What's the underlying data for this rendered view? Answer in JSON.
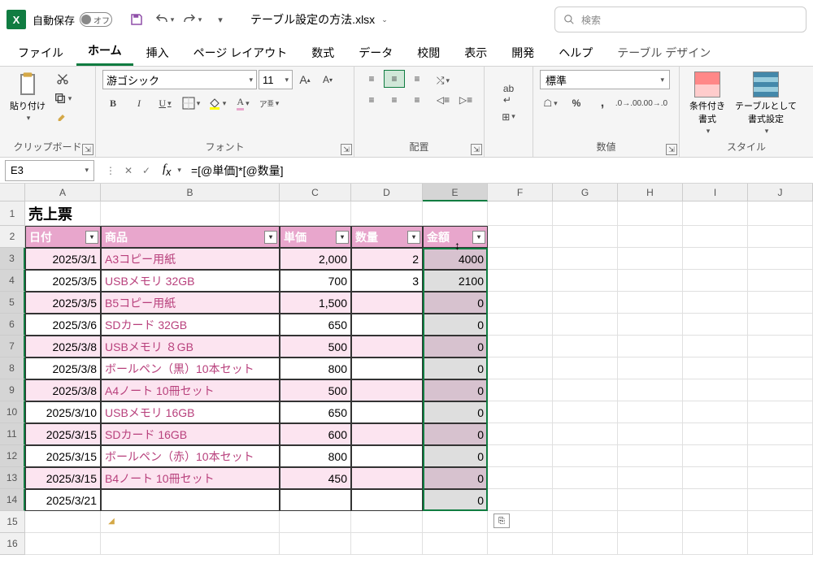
{
  "titlebar": {
    "autosave_label": "自動保存",
    "autosave_state": "オフ",
    "filename": "テーブル設定の方法.xlsx"
  },
  "search": {
    "placeholder": "検索"
  },
  "tabs": {
    "file": "ファイル",
    "home": "ホーム",
    "insert": "挿入",
    "page_layout": "ページ レイアウト",
    "formulas": "数式",
    "data": "データ",
    "review": "校閲",
    "view": "表示",
    "developer": "開発",
    "help": "ヘルプ",
    "table_design": "テーブル デザイン"
  },
  "ribbon": {
    "clipboard": {
      "paste": "貼り付け",
      "group": "クリップボード"
    },
    "font": {
      "name": "游ゴシック",
      "size": "11",
      "group": "フォント"
    },
    "align": {
      "group": "配置"
    },
    "number": {
      "format": "標準",
      "group": "数値"
    },
    "styles": {
      "cond_fmt": "条件付き\n書式",
      "as_table": "テーブルとして\n書式設定",
      "group": "スタイル"
    }
  },
  "namebox": "E3",
  "formula": "=[@単価]*[@数量]",
  "cols": {
    "A": 93,
    "B": 220,
    "C": 88,
    "D": 88,
    "E": 80,
    "F": 80,
    "G": 80,
    "H": 80,
    "I": 80,
    "J": 80
  },
  "row_heights": {
    "title": 30,
    "normal": 27
  },
  "sheet": {
    "title": "売上票",
    "headers": {
      "date": "日付",
      "product": "商品",
      "price": "単価",
      "qty": "数量",
      "amount": "金額"
    },
    "rows": [
      {
        "date": "2025/3/1",
        "product": "A3コピー用紙",
        "price": "2,000",
        "qty": "2",
        "amount": "4000"
      },
      {
        "date": "2025/3/5",
        "product": "USBメモリ 32GB",
        "price": "700",
        "qty": "3",
        "amount": "2100"
      },
      {
        "date": "2025/3/5",
        "product": "B5コピー用紙",
        "price": "1,500",
        "qty": "",
        "amount": "0"
      },
      {
        "date": "2025/3/6",
        "product": "SDカード 32GB",
        "price": "650",
        "qty": "",
        "amount": "0"
      },
      {
        "date": "2025/3/8",
        "product": "USBメモリ ８GB",
        "price": "500",
        "qty": "",
        "amount": "0"
      },
      {
        "date": "2025/3/8",
        "product": "ボールペン（黒）10本セット",
        "price": "800",
        "qty": "",
        "amount": "0"
      },
      {
        "date": "2025/3/8",
        "product": "A4ノート 10冊セット",
        "price": "500",
        "qty": "",
        "amount": "0"
      },
      {
        "date": "2025/3/10",
        "product": "USBメモリ 16GB",
        "price": "650",
        "qty": "",
        "amount": "0"
      },
      {
        "date": "2025/3/15",
        "product": "SDカード 16GB",
        "price": "600",
        "qty": "",
        "amount": "0"
      },
      {
        "date": "2025/3/15",
        "product": "ボールペン（赤）10本セット",
        "price": "800",
        "qty": "",
        "amount": "0"
      },
      {
        "date": "2025/3/15",
        "product": "B4ノート 10冊セット",
        "price": "450",
        "qty": "",
        "amount": "0"
      },
      {
        "date": "2025/3/21",
        "product": "",
        "price": "",
        "qty": "",
        "amount": "0"
      }
    ]
  }
}
